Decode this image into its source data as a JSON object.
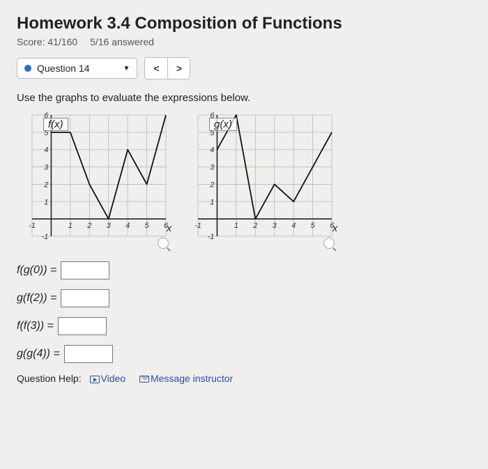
{
  "title": "Homework 3.4 Composition of Functions",
  "score_label": "Score: 41/160",
  "answered_label": "5/16 answered",
  "question_selector": {
    "label": "Question 14",
    "prev": "<",
    "next": ">"
  },
  "instruction": "Use the graphs to evaluate the expressions below.",
  "graph_f": {
    "label": "f(x)",
    "axis": "x"
  },
  "graph_g": {
    "label": "g(x)",
    "axis": "x"
  },
  "chart_data": [
    {
      "type": "line",
      "name": "f(x)",
      "xlim": [
        -1,
        6
      ],
      "ylim": [
        -1,
        6
      ],
      "x": [
        0,
        1,
        2,
        3,
        4,
        5,
        6
      ],
      "values": [
        5,
        5,
        2,
        0,
        4,
        2,
        6
      ]
    },
    {
      "type": "line",
      "name": "g(x)",
      "xlim": [
        -1,
        6
      ],
      "ylim": [
        -1,
        6
      ],
      "x": [
        0,
        1,
        2,
        3,
        4,
        5,
        6
      ],
      "values": [
        4,
        6,
        0,
        2,
        1,
        3,
        5
      ]
    }
  ],
  "answers": [
    {
      "lhs": "f(g(0)) ="
    },
    {
      "lhs": "g(f(2)) ="
    },
    {
      "lhs": "f(f(3)) ="
    },
    {
      "lhs": "g(g(4)) ="
    }
  ],
  "help": {
    "label": "Question Help:",
    "video": "Video",
    "msg": "Message instructor"
  }
}
